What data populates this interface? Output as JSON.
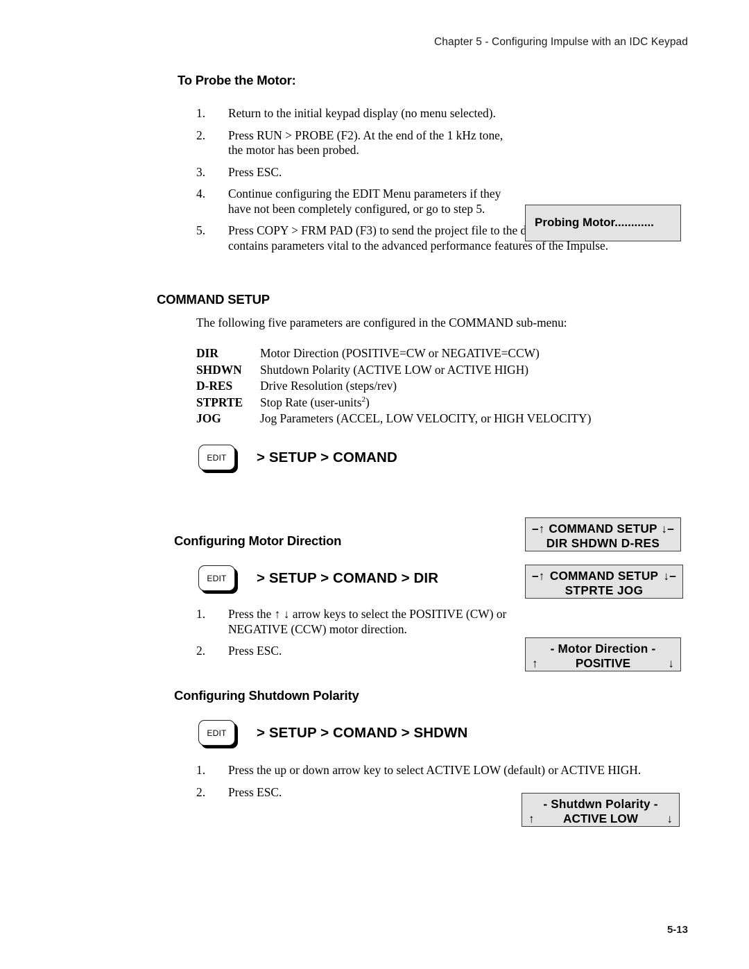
{
  "header": {
    "running_head": "Chapter 5 - Configuring Impulse with an IDC Keypad",
    "page_number": "5-13"
  },
  "probe_section": {
    "heading": "To Probe the Motor:",
    "steps": [
      {
        "num": "1.",
        "text": "Return to the initial keypad display (no menu selected)."
      },
      {
        "num": "2.",
        "text": "Press RUN > PROBE (F2). At the end of the 1 kHz tone, the motor has been probed."
      },
      {
        "num": "3.",
        "text": "Press ESC."
      },
      {
        "num": "4.",
        "text": "Continue configuring the EDIT Menu parameters if they have not been completely configured, or go to step 5."
      },
      {
        "num": "5.",
        "text": "Press COPY > FRM PAD (F3) to send the project file to the drive. Your project file now contains parameters vital to the advanced performance features of the Impulse."
      }
    ],
    "lcd_probing": "Probing Motor............"
  },
  "command_setup": {
    "heading": "COMMAND SETUP",
    "intro": "The following five parameters are configured in the COMMAND sub-menu:",
    "parameters": [
      {
        "name": "DIR",
        "desc": "Motor Direction (POSITIVE=CW or NEGATIVE=CCW)"
      },
      {
        "name": "SHDWN",
        "desc": "Shutdown Polarity (ACTIVE LOW or ACTIVE HIGH)"
      },
      {
        "name": "D-RES",
        "desc": "Drive Resolution (steps/rev)"
      },
      {
        "name": "STPRTE",
        "desc_pre": "Stop Rate (user-units",
        "desc_sup": "2",
        "desc_post": ")"
      },
      {
        "name": "JOG",
        "desc": "Jog Parameters (ACCEL, LOW VELOCITY, or HIGH VELOCITY)"
      }
    ],
    "key_label": "EDIT",
    "menu_path": "> SETUP > COMAND",
    "lcd_1": {
      "left_dash": "–",
      "up_arrow": "↑",
      "title": "COMMAND SETUP",
      "down_arrow": "↓",
      "right_dash": "–",
      "items": "DIR  SHDWN  D-RES"
    },
    "lcd_2": {
      "left_dash": "–",
      "up_arrow": "↑",
      "title": "COMMAND SETUP",
      "down_arrow": "↓",
      "right_dash": "–",
      "items": "STPRTE  JOG"
    }
  },
  "motor_direction": {
    "heading": "Configuring Motor Direction",
    "key_label": "EDIT",
    "menu_path": "> SETUP > COMAND > DIR",
    "lcd": {
      "title": "- Motor   Direction -",
      "up_arrow": "↑",
      "value": "POSITIVE",
      "down_arrow": "↓"
    },
    "steps": [
      {
        "num": "1.",
        "text": "Press the ↑ ↓ arrow keys to select the POSITIVE (CW) or NEGATIVE (CCW) motor direction."
      },
      {
        "num": "2.",
        "text": "Press ESC."
      }
    ]
  },
  "shutdown_polarity": {
    "heading": "Configuring Shutdown Polarity",
    "key_label": "EDIT",
    "menu_path": "> SETUP > COMAND > SHDWN",
    "lcd": {
      "title": "-  Shutdwn  Polarity  -",
      "up_arrow": "↑",
      "value": "ACTIVE LOW",
      "down_arrow": "↓"
    },
    "steps": [
      {
        "num": "1.",
        "text": "Press the up or down arrow key to select ACTIVE LOW (default) or ACTIVE HIGH."
      },
      {
        "num": "2.",
        "text": "Press ESC."
      }
    ]
  },
  "colors": {
    "lcd_background": "#e3e3e3",
    "lcd_border": "#3c3c3c",
    "text": "#000000",
    "page_background": "#ffffff"
  }
}
